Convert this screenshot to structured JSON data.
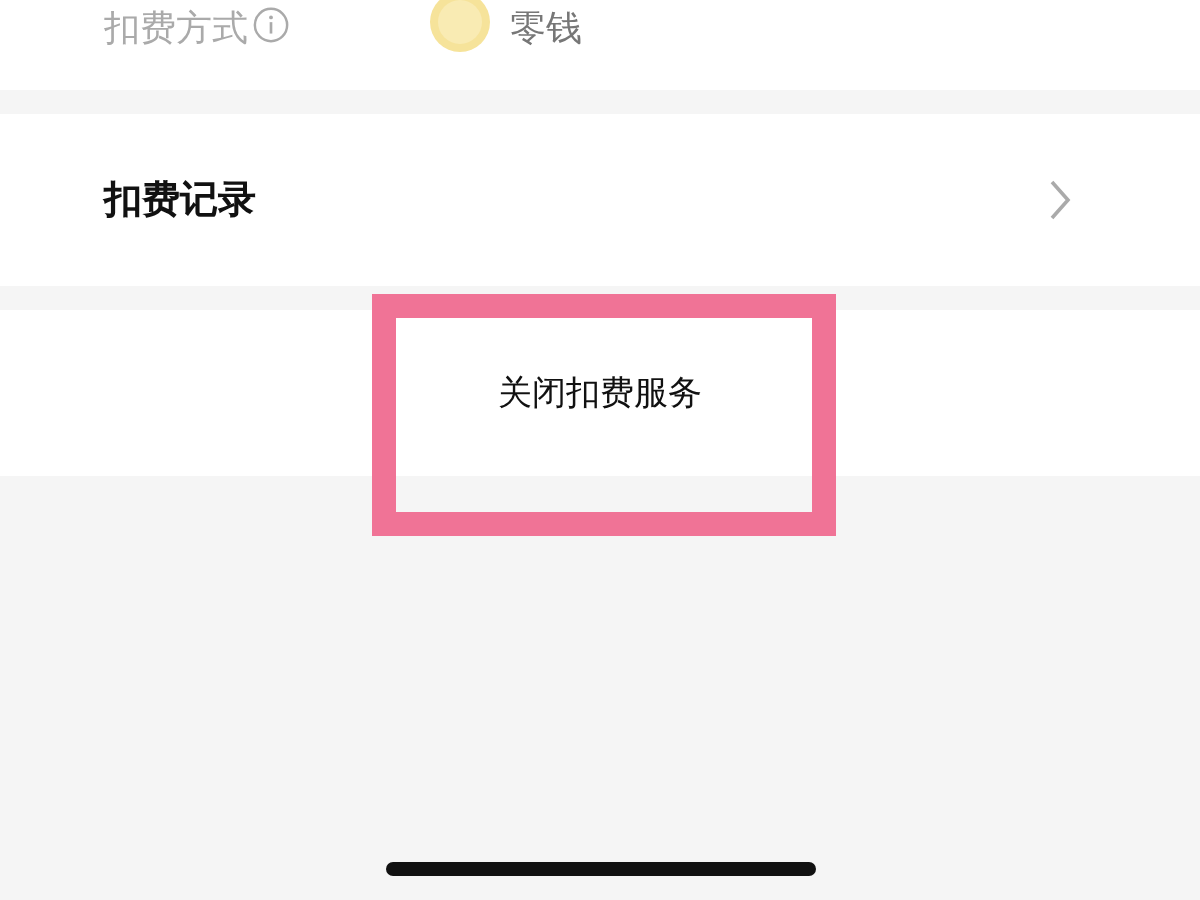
{
  "payment_method": {
    "label": "扣费方式",
    "value": "零钱"
  },
  "records": {
    "label": "扣费记录"
  },
  "close_button": {
    "label": "关闭扣费服务"
  }
}
